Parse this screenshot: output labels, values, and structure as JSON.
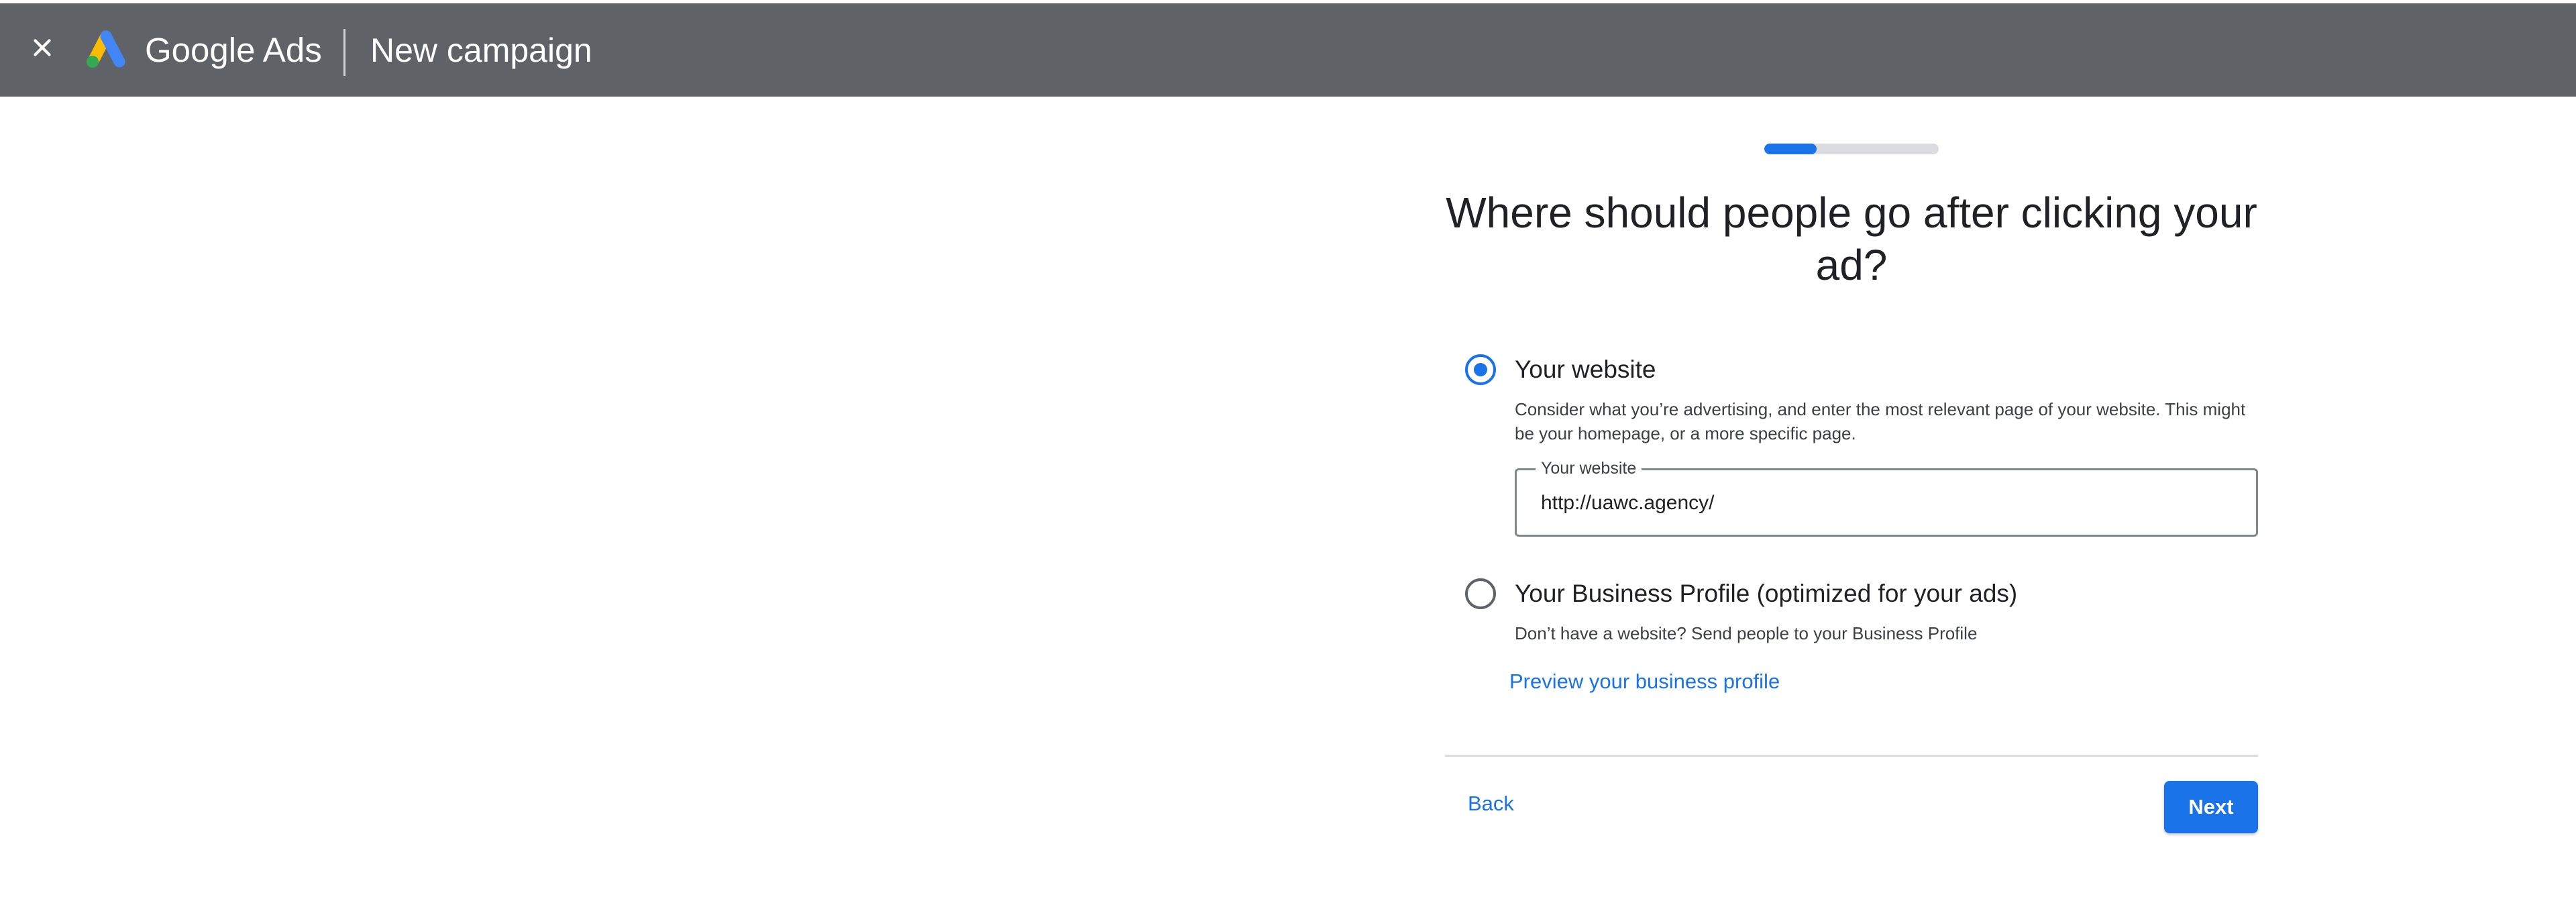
{
  "header": {
    "close_icon": "close-icon",
    "logo_icon": "google-ads-logo-icon",
    "brand": "Google Ads",
    "title": "New campaign",
    "background_color": "#5f6368"
  },
  "progress": {
    "fraction": 0.3
  },
  "question": "Where should people go after clicking your ad?",
  "options": [
    {
      "label": "Your website",
      "selected": true,
      "description": "Consider what you’re advertising, and enter the most relevant page of your website. This might be your homepage, or a more specific page.",
      "field": {
        "label": "Your website",
        "value": "http://uawc.agency/"
      }
    },
    {
      "label": "Your Business Profile (optimized for your ads)",
      "selected": false,
      "description": "Don’t have a website? Send people to your Business Profile",
      "link": "Preview your business profile"
    }
  ],
  "footer": {
    "back_label": "Back",
    "next_label": "Next"
  },
  "colors": {
    "accent": "#1a73e8",
    "text": "#202124",
    "divider": "#dadce0"
  }
}
